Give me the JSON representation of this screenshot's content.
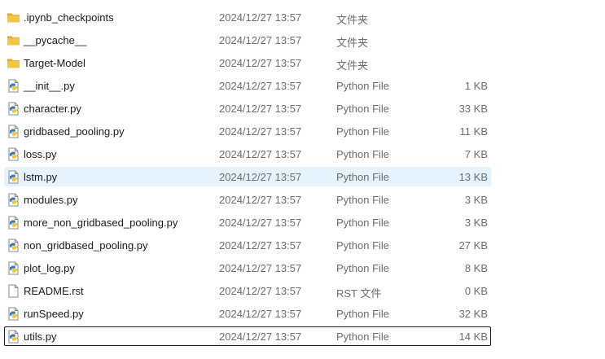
{
  "files": [
    {
      "name": ".ipynb_checkpoints",
      "date": "2024/12/27 13:57",
      "type": "文件夹",
      "size": "",
      "icon": "folder-icon"
    },
    {
      "name": "__pycache__",
      "date": "2024/12/27 13:57",
      "type": "文件夹",
      "size": "",
      "icon": "folder-icon"
    },
    {
      "name": "Target-Model",
      "date": "2024/12/27 13:57",
      "type": "文件夹",
      "size": "",
      "icon": "folder-icon"
    },
    {
      "name": "__init__.py",
      "date": "2024/12/27 13:57",
      "type": "Python File",
      "size": "1 KB",
      "icon": "python-file-icon"
    },
    {
      "name": "character.py",
      "date": "2024/12/27 13:57",
      "type": "Python File",
      "size": "33 KB",
      "icon": "python-file-icon"
    },
    {
      "name": "gridbased_pooling.py",
      "date": "2024/12/27 13:57",
      "type": "Python File",
      "size": "11 KB",
      "icon": "python-file-icon"
    },
    {
      "name": "loss.py",
      "date": "2024/12/27 13:57",
      "type": "Python File",
      "size": "7 KB",
      "icon": "python-file-icon"
    },
    {
      "name": "lstm.py",
      "date": "2024/12/27 13:57",
      "type": "Python File",
      "size": "13 KB",
      "icon": "python-file-icon",
      "state": "selected"
    },
    {
      "name": "modules.py",
      "date": "2024/12/27 13:57",
      "type": "Python File",
      "size": "3 KB",
      "icon": "python-file-icon"
    },
    {
      "name": "more_non_gridbased_pooling.py",
      "date": "2024/12/27 13:57",
      "type": "Python File",
      "size": "3 KB",
      "icon": "python-file-icon"
    },
    {
      "name": "non_gridbased_pooling.py",
      "date": "2024/12/27 13:57",
      "type": "Python File",
      "size": "27 KB",
      "icon": "python-file-icon"
    },
    {
      "name": "plot_log.py",
      "date": "2024/12/27 13:57",
      "type": "Python File",
      "size": "8 KB",
      "icon": "python-file-icon"
    },
    {
      "name": "README.rst",
      "date": "2024/12/27 13:57",
      "type": "RST 文件",
      "size": "0 KB",
      "icon": "text-file-icon"
    },
    {
      "name": "runSpeed.py",
      "date": "2024/12/27 13:57",
      "type": "Python File",
      "size": "32 KB",
      "icon": "python-file-icon"
    },
    {
      "name": "utils.py",
      "date": "2024/12/27 13:57",
      "type": "Python File",
      "size": "14 KB",
      "icon": "python-file-icon",
      "state": "focused"
    }
  ],
  "colors": {
    "folder": "#f4c542",
    "folder_dark": "#e0a820",
    "python_blue": "#3a75b0",
    "python_yellow": "#f2c530",
    "selection": "#e5f3ff",
    "secondary_text": "#6d6d6d"
  }
}
